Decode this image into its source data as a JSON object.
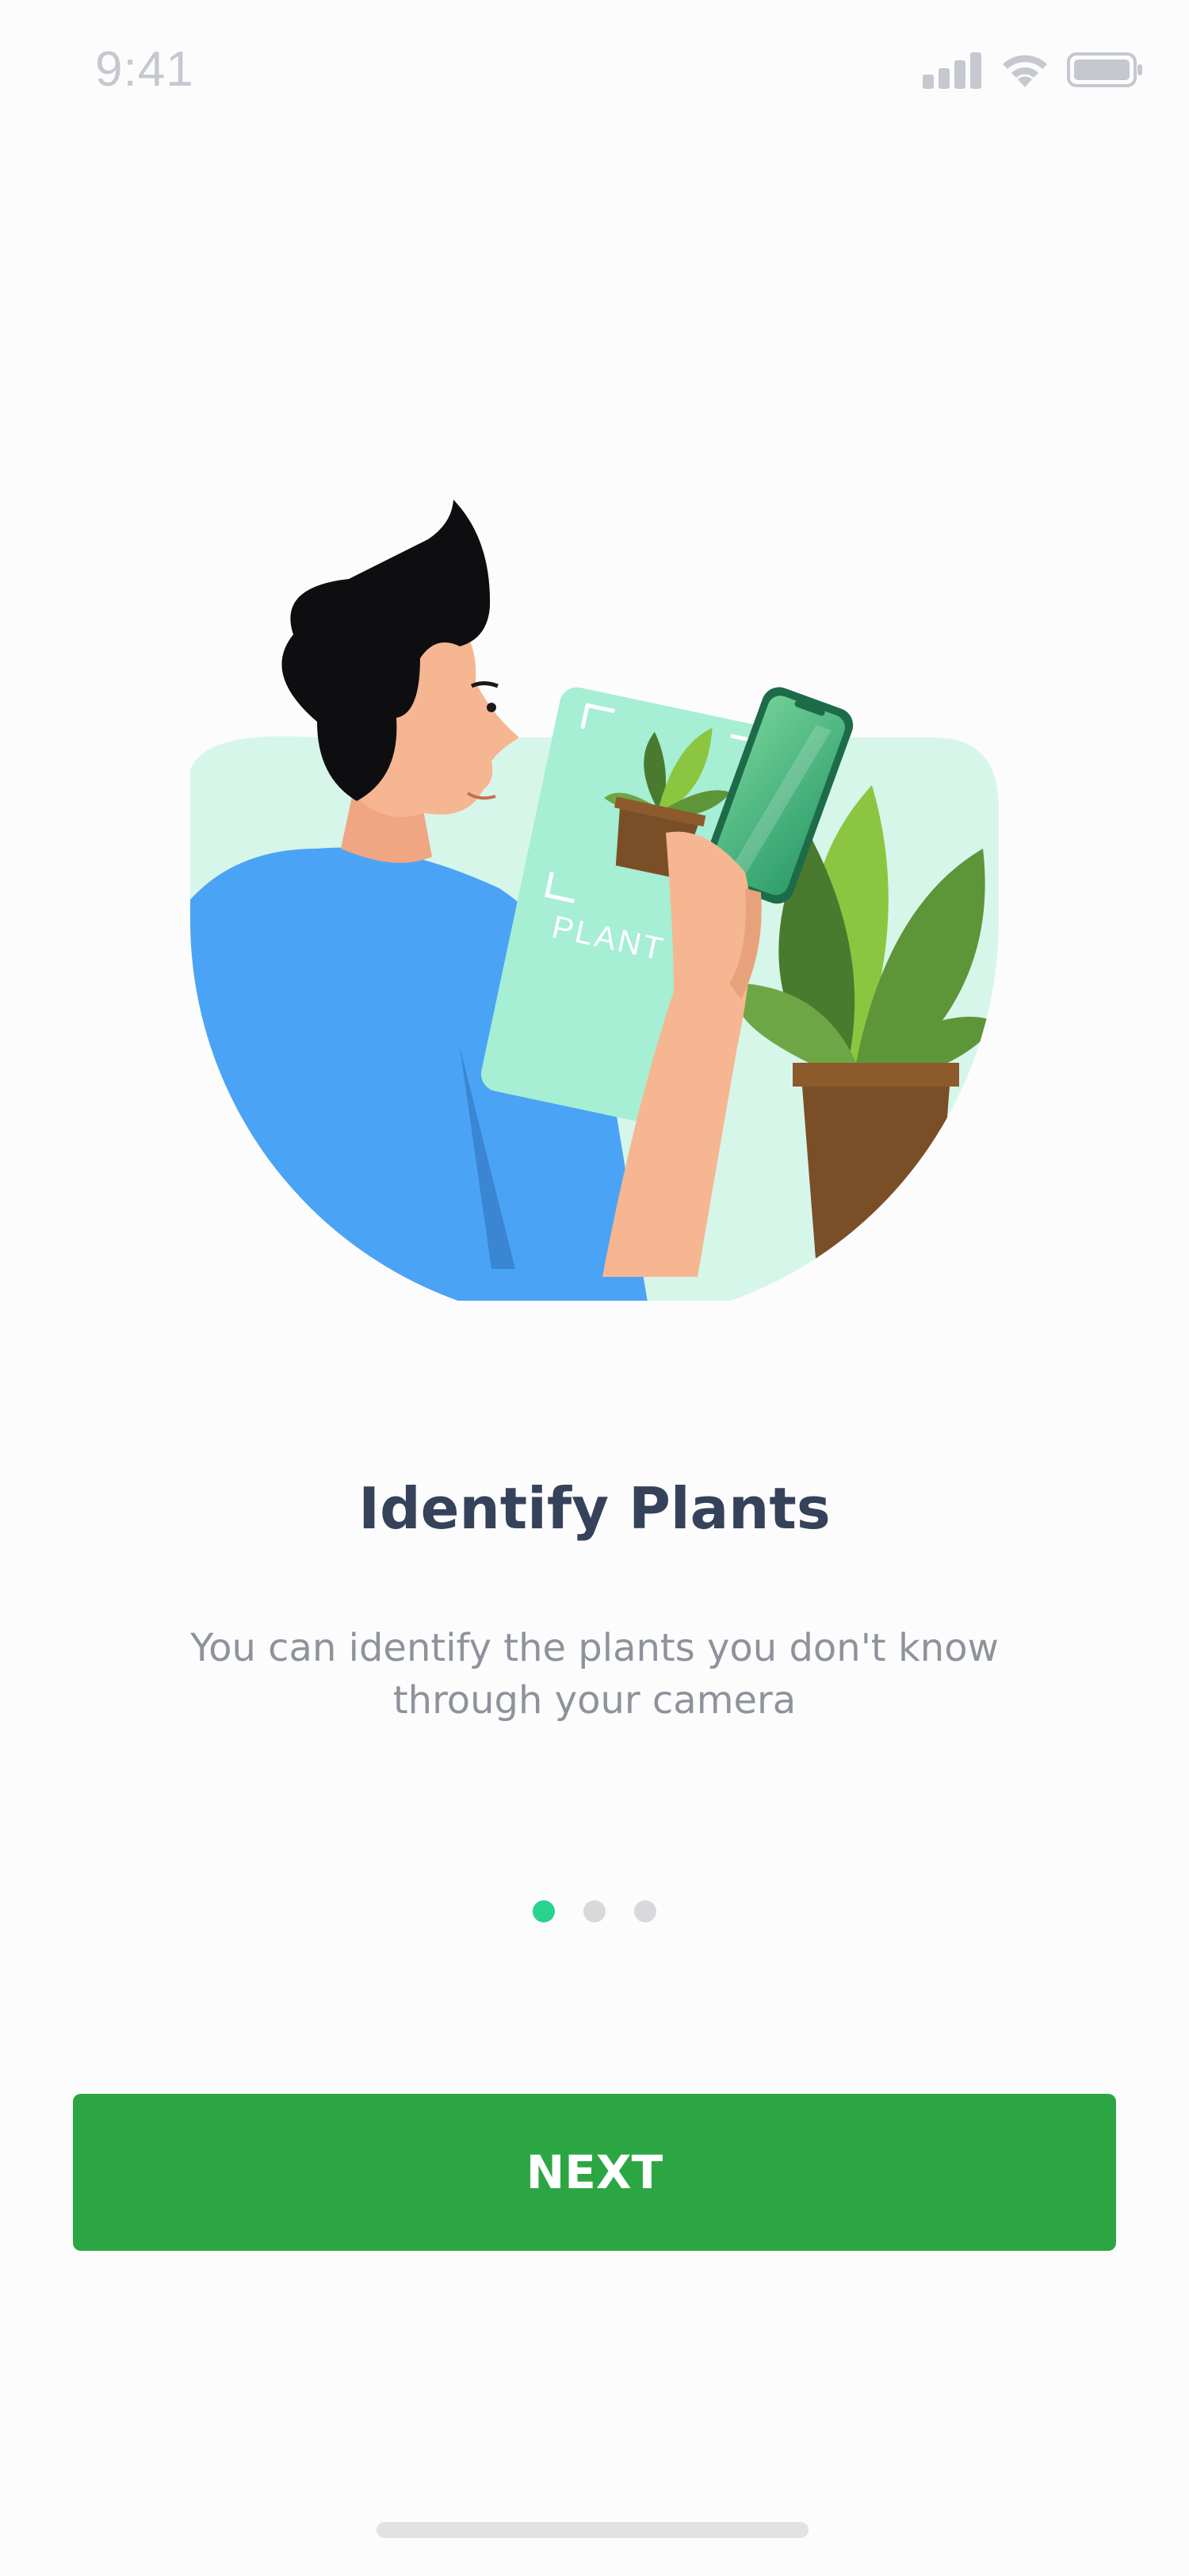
{
  "status_bar": {
    "time": "9:41",
    "icons": [
      "cellular-signal-icon",
      "wifi-icon",
      "battery-icon"
    ]
  },
  "illustration": {
    "card_label": "PLANT"
  },
  "onboarding": {
    "title": "Identify Plants",
    "subtitle_line1": "You can identify the plants you don't know",
    "subtitle_line2": "through your camera",
    "page_indicator": {
      "current": 1,
      "total": 3
    }
  },
  "actions": {
    "next_label": "NEXT"
  },
  "colors": {
    "primary": "#2ca643",
    "indicator_active": "#2ad28f",
    "indicator_inactive": "#d9d9dc",
    "title": "#36425a",
    "subtitle": "#8e939b"
  }
}
